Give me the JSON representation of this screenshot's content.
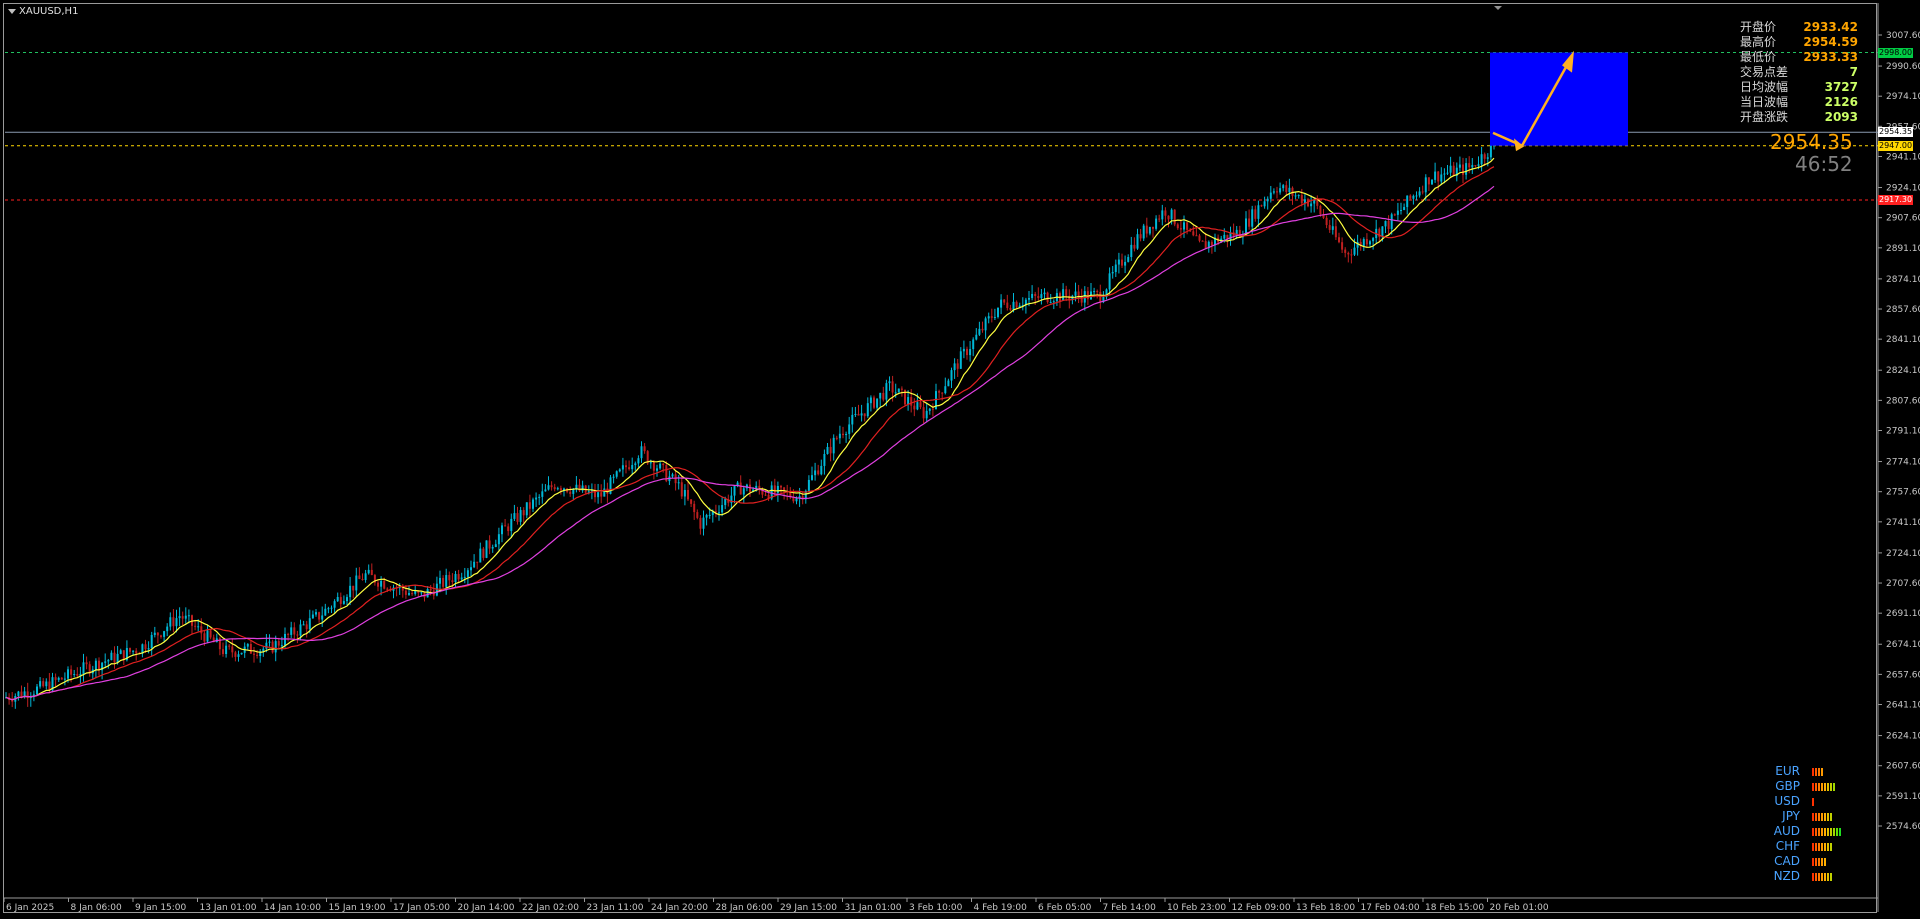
{
  "window": {
    "symbol_title": "XAUUSD,H1"
  },
  "info_panel": [
    {
      "label": "开盘价",
      "value": "2933.42",
      "color": "#ffa500"
    },
    {
      "label": "最高价",
      "value": "2954.59",
      "color": "#ffa500"
    },
    {
      "label": "最低价",
      "value": "2933.33",
      "color": "#ffa500"
    },
    {
      "label": "交易点差",
      "value": "7",
      "color": "#ccff66"
    },
    {
      "label": "日均波幅",
      "value": "3727",
      "color": "#ccff66"
    },
    {
      "label": "当日波幅",
      "value": "2126",
      "color": "#ccff66"
    },
    {
      "label": "开盘涨跌",
      "value": "2093",
      "color": "#ccff66"
    }
  ],
  "current_price": "2954.35",
  "countdown": "46:52",
  "price_axis": {
    "ticks": [
      "3007.60",
      "2990.60",
      "2974.10",
      "2957.60",
      "2941.10",
      "2924.10",
      "2907.60",
      "2891.10",
      "2874.10",
      "2857.60",
      "2841.10",
      "2824.10",
      "2807.60",
      "2791.10",
      "2774.10",
      "2757.60",
      "2741.10",
      "2724.10",
      "2707.60",
      "2691.10",
      "2674.10",
      "2657.60",
      "2641.10",
      "2624.10",
      "2607.60",
      "2591.10",
      "2574.60"
    ],
    "tags": [
      {
        "text": "2998.00",
        "color": "#00cc44",
        "text_color": "#000000"
      },
      {
        "text": "2954.35",
        "color": "#ffffff",
        "text_color": "#000000"
      },
      {
        "text": "2947.00",
        "color": "#ffd700",
        "text_color": "#000000"
      },
      {
        "text": "2917.30",
        "color": "#ff2020",
        "text_color": "#ffffff"
      }
    ]
  },
  "time_axis": [
    "6 Jan 2025",
    "8 Jan 06:00",
    "9 Jan 15:00",
    "13 Jan 01:00",
    "14 Jan 10:00",
    "15 Jan 19:00",
    "17 Jan 05:00",
    "20 Jan 14:00",
    "22 Jan 02:00",
    "23 Jan 11:00",
    "24 Jan 20:00",
    "28 Jan 06:00",
    "29 Jan 15:00",
    "31 Jan 01:00",
    "3 Feb 10:00",
    "4 Feb 19:00",
    "6 Feb 05:00",
    "7 Feb 14:00",
    "10 Feb 23:00",
    "12 Feb 09:00",
    "13 Feb 18:00",
    "17 Feb 04:00",
    "18 Feb 15:00",
    "20 Feb 01:00"
  ],
  "currency_strength": [
    {
      "name": "EUR",
      "level": 4
    },
    {
      "name": "GBP",
      "level": 8
    },
    {
      "name": "USD",
      "level": 1
    },
    {
      "name": "JPY",
      "level": 7
    },
    {
      "name": "AUD",
      "level": 10
    },
    {
      "name": "CHF",
      "level": 7
    },
    {
      "name": "CAD",
      "level": 5
    },
    {
      "name": "NZD",
      "level": 7
    }
  ],
  "colors": {
    "bull": "#00b8d8",
    "bear": "#c02020",
    "ma_fast": "#ffff40",
    "ma_mid": "#e02020",
    "ma_slow": "#e040e0",
    "box": "#0000ff",
    "arrow": "#ffb020"
  }
}
